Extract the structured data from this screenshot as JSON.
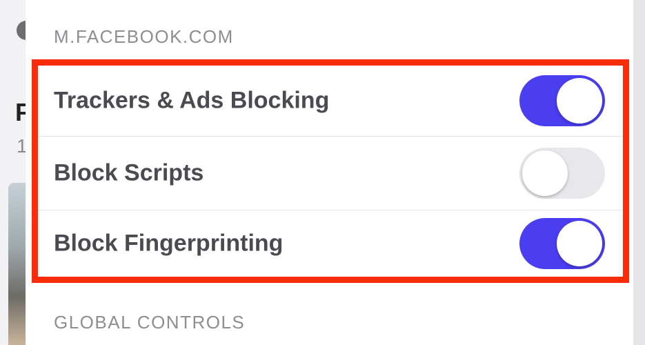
{
  "site_section": {
    "header": "M.FACEBOOK.COM"
  },
  "global_section": {
    "header": "GLOBAL CONTROLS"
  },
  "settings": [
    {
      "label": "Trackers & Ads Blocking",
      "enabled": true
    },
    {
      "label": "Block Scripts",
      "enabled": false
    },
    {
      "label": "Block Fingerprinting",
      "enabled": true
    }
  ],
  "colors": {
    "toggle_on": "#4b3df0",
    "toggle_off": "#e8e8ec",
    "highlight_border": "#fb2d08",
    "header_text": "#8d8d92",
    "label_text": "#4a4a50"
  },
  "background": {
    "title_letter": "F",
    "subtitle_digit": "1"
  }
}
